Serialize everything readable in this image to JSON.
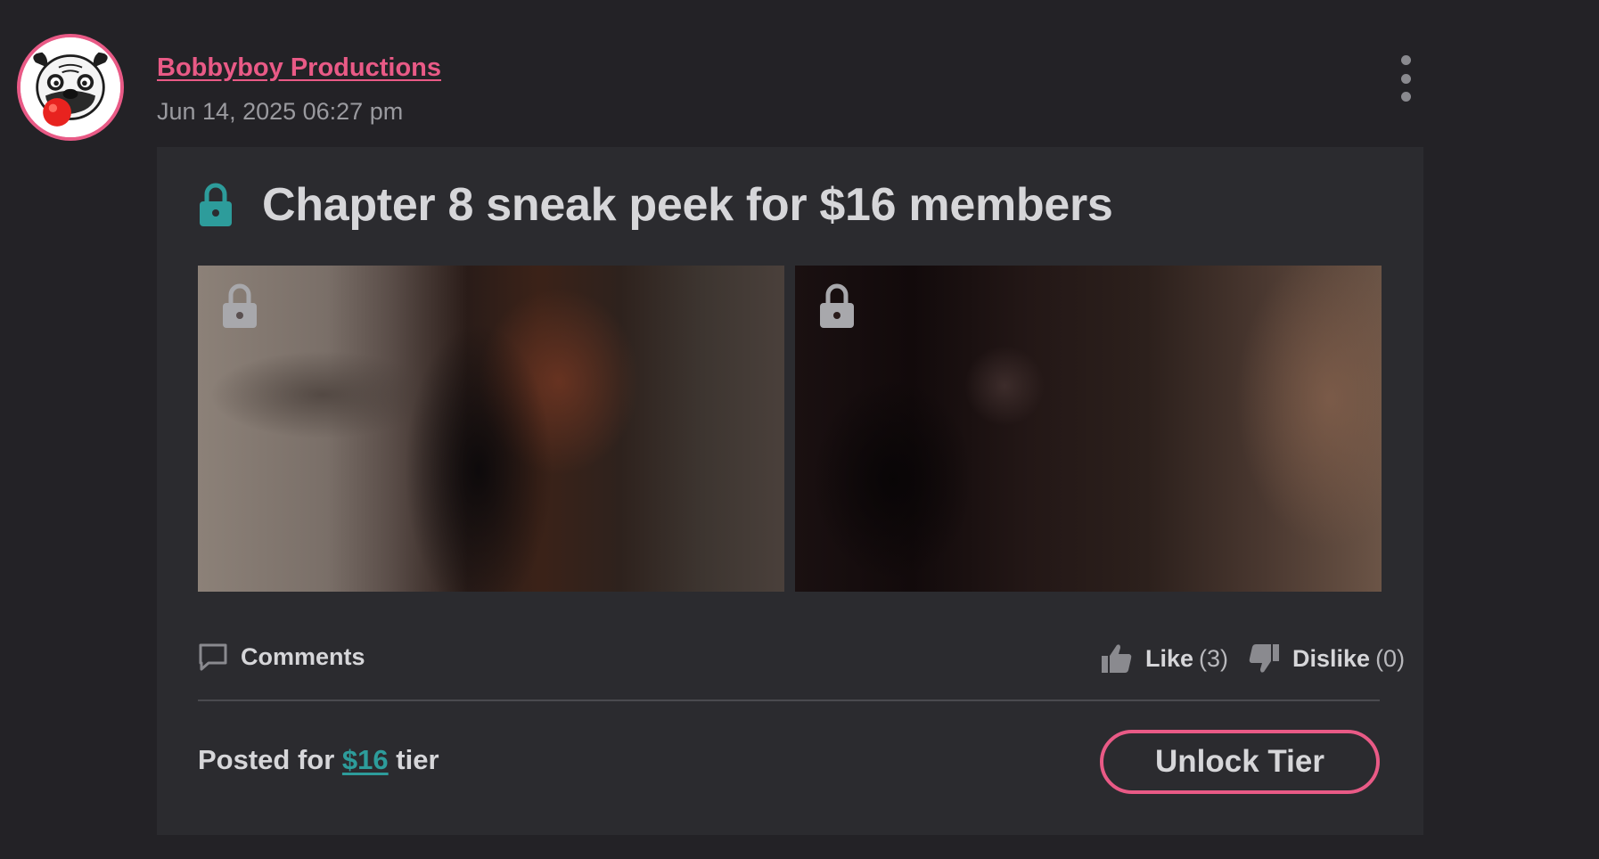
{
  "author": {
    "name": "Bobbyboy Productions",
    "posted_at": "Jun 14, 2025 06:27 pm"
  },
  "post": {
    "title": "Chapter 8 sneak peek for $16 members",
    "locked": true,
    "media_count_visible": 2
  },
  "actions": {
    "comments_label": "Comments",
    "like_label": "Like",
    "like_count": "(3)",
    "dislike_label": "Dislike",
    "dislike_count": "(0)"
  },
  "footer": {
    "posted_for_prefix": "Posted for",
    "tier_price": "$16",
    "posted_for_suffix": "tier",
    "unlock_button_label": "Unlock Tier"
  },
  "colors": {
    "background": "#232226",
    "card": "#2b2b2f",
    "accent_pink": "#e95a86",
    "accent_teal": "#2d9c9b",
    "text_primary": "#d6d6d9",
    "text_muted": "#9a9a9f"
  },
  "icons": {
    "avatar": "pug-logo-avatar",
    "title_lock": "lock-icon",
    "media_lock": "lock-icon",
    "menu": "more-vertical-icon",
    "comments": "comment-bubble-icon",
    "like": "thumbs-up-icon",
    "dislike": "thumbs-down-icon"
  }
}
